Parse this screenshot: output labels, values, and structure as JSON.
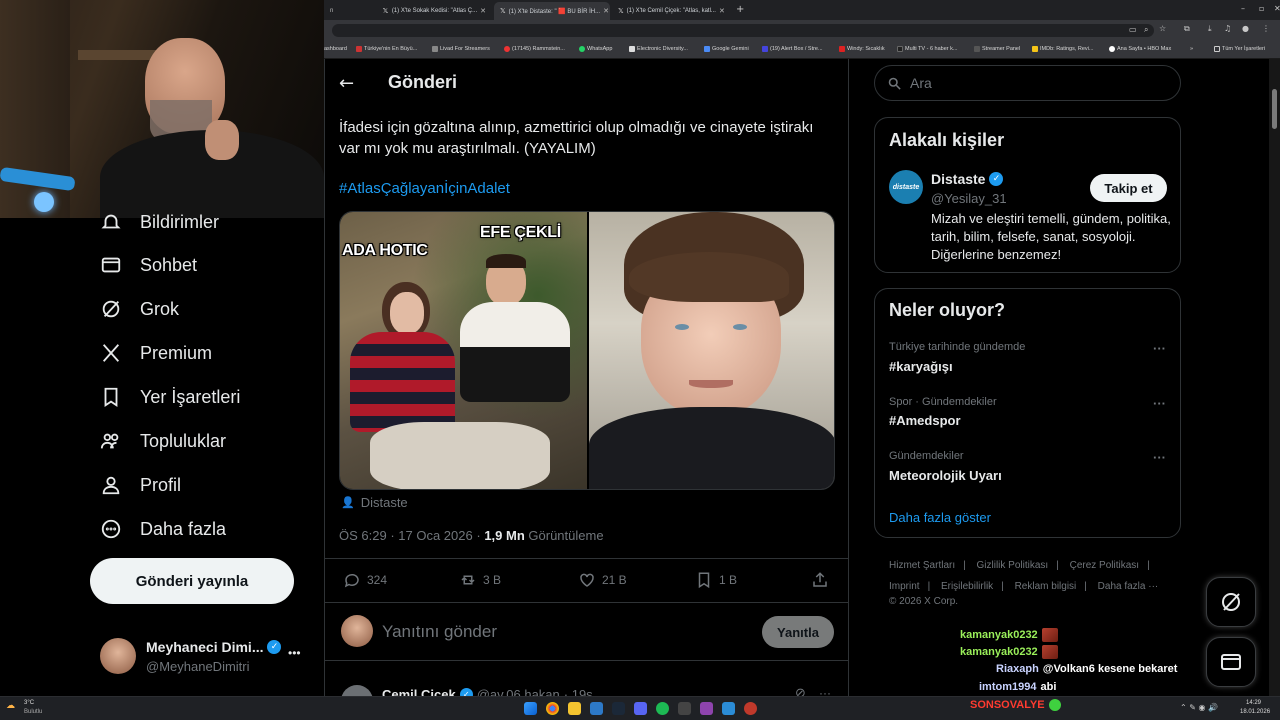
{
  "browser": {
    "tabs": [
      {
        "title": "(1) X'te Sokak Kedisi: \"Atlas Ç...",
        "active": false
      },
      {
        "title": "(1) X'te Distaste: \" 🟥 BU BİR İH...",
        "active": true
      },
      {
        "title": "(1) X'te Cemil Çiçek: \"Atlas, katl...",
        "active": false
      }
    ],
    "bookmarks": [
      "ashboard",
      "Türkiye'nin En Büyü...",
      "Livad For Streamers",
      "(17145) Rammstein...",
      "WhatsApp",
      "Electronic Diversity...",
      "Google Gemini",
      "(19) Alert Box / Stre...",
      "Windy: Sıcaklık",
      "Multi TV - 6 haber k...",
      "Streamer Panel",
      "IMDb: Ratings, Revi...",
      "Ana Sayfa • HBO Max",
      "Tüm Yer İşaretleri"
    ]
  },
  "nav": {
    "items": [
      {
        "label": "Bildirimler",
        "icon": "bell-icon"
      },
      {
        "label": "Sohbet",
        "icon": "mail-icon"
      },
      {
        "label": "Grok",
        "icon": "grok-icon"
      },
      {
        "label": "Premium",
        "icon": "x-logo-icon"
      },
      {
        "label": "Yer İşaretleri",
        "icon": "bookmark-icon"
      },
      {
        "label": "Topluluklar",
        "icon": "communities-icon"
      },
      {
        "label": "Profil",
        "icon": "profile-icon"
      },
      {
        "label": "Daha fazla",
        "icon": "more-circle-icon"
      }
    ],
    "post_button": "Gönderi yayınla",
    "account": {
      "name": "Meyhaneci Dimi...",
      "handle": "@MeyhaneDimitri",
      "more": "•••"
    }
  },
  "main": {
    "header_title": "Gönderi",
    "tweet_text": "İfadesi için gözaltına alınıp, azmettirici olup olmadığı ve cinayete iştirakı var mı yok mu araştırılmalı. (YAYALIM)",
    "hashtag": "#AtlasÇağlayanİçinAdalet",
    "media_labels": {
      "left_a": "ADA HOTIC",
      "left_b": "EFE ÇEKLİ"
    },
    "media_credit": "Distaste",
    "meta": {
      "time": "ÖS 6:29",
      "date": "17 Oca 2026",
      "views_value": "1,9 Mn",
      "views_label": "Görüntüleme"
    },
    "stats": {
      "replies": "324",
      "retweets": "3 B",
      "likes": "21 B",
      "bookmarks": "1 B"
    },
    "reply_placeholder": "Yanıtını gönder",
    "reply_button": "Yanıtla",
    "next_tweet": {
      "name": "Cemil Çiçek",
      "handle": "@av.06.hakan",
      "time": "· 19s"
    }
  },
  "right": {
    "search_placeholder": "Ara",
    "related": {
      "title": "Alakalı kişiler",
      "name": "Distaste",
      "handle": "@Yesilay_31",
      "bio": "Mizah ve eleştiri temelli, gündem, politika, tarih, bilim, felsefe, sanat, sosyoloji. Diğerlerine benzemez!",
      "follow": "Takip et",
      "avatar_text": "distaste"
    },
    "trends": {
      "title": "Neler oluyor?",
      "items": [
        {
          "context": "Türkiye tarihinde gündemde",
          "name": "#karyağışı"
        },
        {
          "context": "Spor · Gündemdekiler",
          "name": "#Amedspor"
        },
        {
          "context": "Gündemdekiler",
          "name": "Meteorolojik Uyarı"
        }
      ],
      "show_more": "Daha fazla göster"
    },
    "footer": [
      "Hizmet Şartları",
      "|",
      "Gizlilik Politikası",
      "|",
      "Çerez Politikası",
      "|",
      "Imprint",
      "|",
      "Erişilebilirlik",
      "|",
      "Reklam bilgisi",
      "|",
      "Daha fazla ···",
      "© 2026 X Corp."
    ]
  },
  "chat": [
    {
      "user": "kamanyak0232",
      "msg": "",
      "color": "#9aef5a"
    },
    {
      "user": "kamanyak0232",
      "msg": "",
      "color": "#9aef5a"
    },
    {
      "user": "Riaxaph",
      "msg": "@Volkan6 kesene bekaret",
      "color": "#c9d3ff"
    },
    {
      "user": "imtom1994",
      "msg": "abi",
      "color": "#c9d3ff"
    },
    {
      "user": "SONSOVALYE",
      "msg": "",
      "color": "#ff3b30"
    }
  ],
  "taskbar": {
    "weather_temp": "3°C",
    "weather_desc": "Bulutlu",
    "time": "14:29",
    "date": "18.01.2026"
  },
  "colors": {
    "accent": "#1d9bf0",
    "verified": "#1d9bf0",
    "border": "#2f3336",
    "muted": "#71767b"
  }
}
